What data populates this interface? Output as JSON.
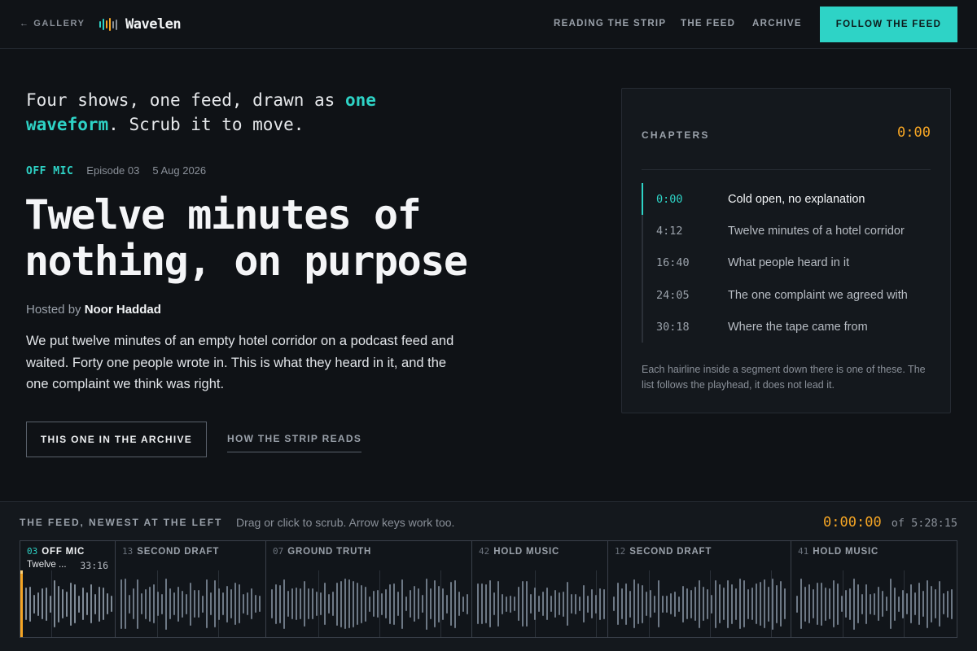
{
  "header": {
    "back_label": "← GALLERY",
    "logo_text": "Wavelen",
    "logo_icon": "waveform-icon",
    "nav": [
      "READING THE STRIP",
      "THE FEED",
      "ARCHIVE"
    ],
    "cta_label": "FOLLOW THE FEED"
  },
  "colors": {
    "accent": "#2ed3c6",
    "playhead": "#f5a524",
    "background": "#0f1216",
    "panel": "#14181d"
  },
  "hero": {
    "tagline_pre": "Four shows, one feed, drawn as ",
    "tagline_highlight": "one waveform",
    "tagline_post": ". Scrub it to move.",
    "show": "OFF MIC",
    "episode": "Episode 03",
    "date": "5 Aug 2026",
    "title": "Twelve minutes of nothing, on purpose",
    "hosted_prefix": "Hosted by",
    "host": "Noor Haddad",
    "description": "We put twelve minutes of an empty hotel corridor on a podcast feed and waited. Forty one people wrote in. This is what they heard in it, and the one complaint we think was right.",
    "archive_button": "THIS ONE IN THE ARCHIVE",
    "strip_link": "HOW THE STRIP READS"
  },
  "chapters": {
    "heading": "CHAPTERS",
    "current_time": "0:00",
    "items": [
      {
        "time": "0:00",
        "label": "Cold open, no explanation",
        "active": true
      },
      {
        "time": "4:12",
        "label": "Twelve minutes of a hotel corridor",
        "active": false
      },
      {
        "time": "16:40",
        "label": "What people heard in it",
        "active": false
      },
      {
        "time": "24:05",
        "label": "The one complaint we agreed with",
        "active": false
      },
      {
        "time": "30:18",
        "label": "Where the tape came from",
        "active": false
      }
    ],
    "note": "Each hairline inside a segment down there is one of these. The list follows the playhead, it does not lead it."
  },
  "feed": {
    "title": "THE FEED, NEWEST AT THE LEFT",
    "hint": "Drag or click to scrub. Arrow keys work too.",
    "current": "0:00:00",
    "total_prefix": "of",
    "total": "5:28:15",
    "playhead_position": 0,
    "segments": [
      {
        "num": "03",
        "show": "OFF MIC",
        "sub_title": "Twelve ...",
        "duration": "33:16",
        "current": true
      },
      {
        "num": "13",
        "show": "SECOND DRAFT",
        "current": false
      },
      {
        "num": "07",
        "show": "GROUND TRUTH",
        "current": false
      },
      {
        "num": "42",
        "show": "HOLD MUSIC",
        "current": false
      },
      {
        "num": "12",
        "show": "SECOND DRAFT",
        "current": false
      },
      {
        "num": "41",
        "show": "HOLD MUSIC",
        "current": false
      }
    ]
  }
}
